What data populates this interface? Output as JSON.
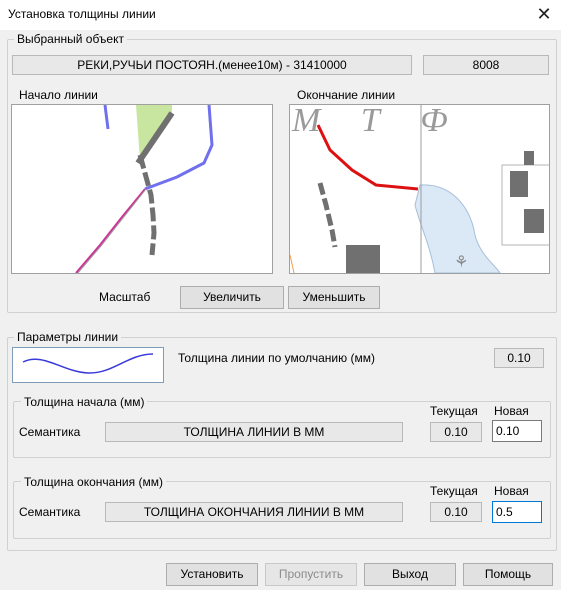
{
  "window": {
    "title": "Установка толщины линии",
    "close_glyph": "✕"
  },
  "selected": {
    "legend": "Выбранный объект",
    "object_name": "РЕКИ,РУЧЬИ ПОСТОЯН.(менее10м) - 31410000",
    "object_code": "8008"
  },
  "maps": {
    "start_label": "Начало линии",
    "end_label": "Окончание линии",
    "map_text": "М Т Ф",
    "scale_label": "Масштаб",
    "zoom_in": "Увеличить",
    "zoom_out": "Уменьшить"
  },
  "params": {
    "legend": "Параметры линии",
    "default_label": "Толщина линии по умолчанию (мм)",
    "default_value": "0.10"
  },
  "start_thickness": {
    "legend": "Толщина начала (мм)",
    "current_header": "Текущая",
    "new_header": "Новая",
    "semantics_label": "Семантика",
    "semantics_value": "ТОЛЩИНА ЛИНИИ В ММ",
    "current_value": "0.10",
    "new_value": "0.10"
  },
  "end_thickness": {
    "legend": "Толщина окончания (мм)",
    "current_header": "Текущая",
    "new_header": "Новая",
    "semantics_label": "Семантика",
    "semantics_value": "ТОЛЩИНА ОКОНЧАНИЯ ЛИНИИ В ММ",
    "current_value": "0.10",
    "new_value": "0.5"
  },
  "buttons": {
    "set": "Установить",
    "skip": "Пропустить",
    "exit": "Выход",
    "help": "Помощь"
  },
  "colors": {
    "river_line": "#7070ee",
    "start_line_color": "#cc3399",
    "end_line_color": "#dd1111",
    "vegetation": "#c8e6a0",
    "water": "#dbe9f6",
    "focus_border": "#0078d7"
  }
}
